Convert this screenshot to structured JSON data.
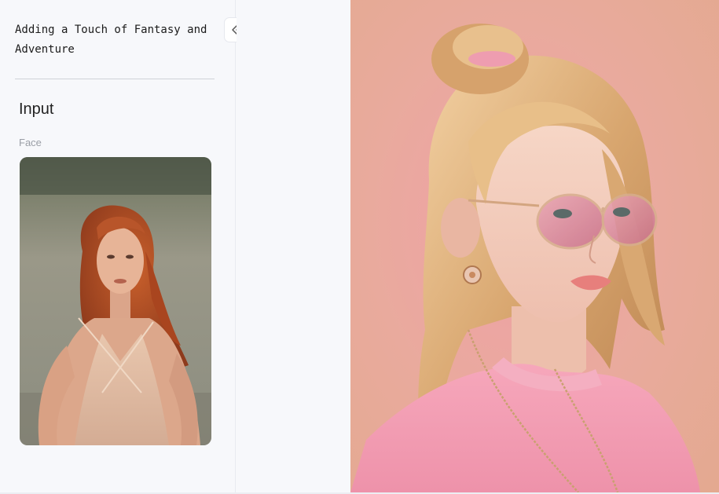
{
  "sidebar": {
    "title": "Adding a Touch of Fantasy and Adventure",
    "section_title": "Input",
    "face_label": "Face"
  },
  "icons": {
    "collapse": "double-chevron-left-icon"
  },
  "colors": {
    "background": "#f7f8fb",
    "output_background": "#e6a89a",
    "sweater": "#f29bb0"
  }
}
